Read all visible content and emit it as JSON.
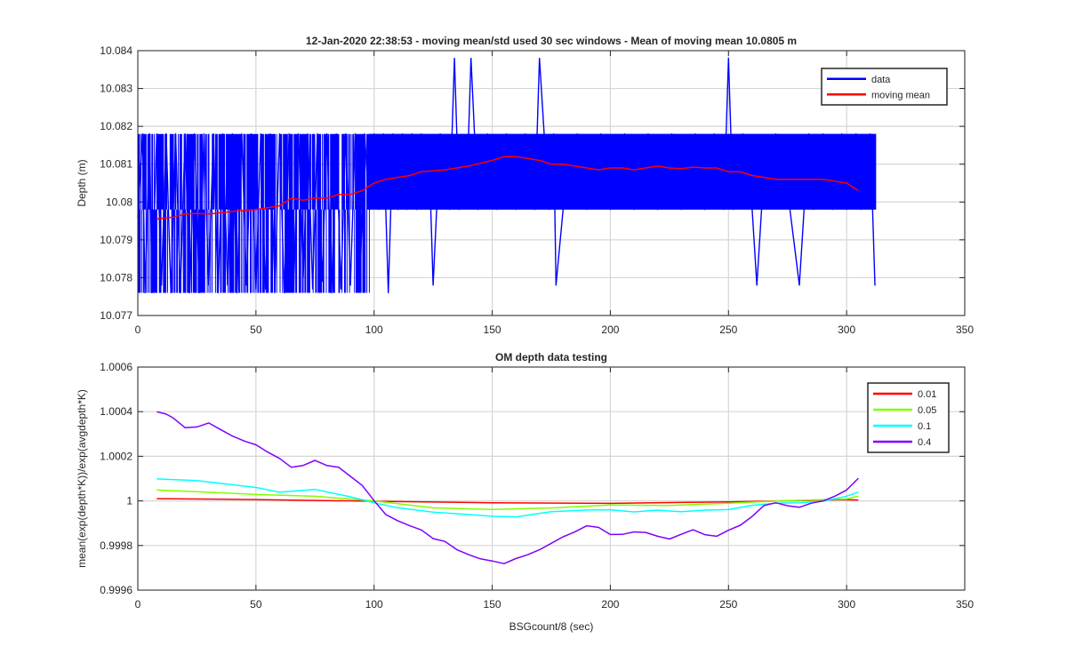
{
  "figure": {
    "background": "#ffffff"
  },
  "chart_data": [
    {
      "type": "line",
      "title": "12-Jan-2020 22:38:53 - moving mean/std used 30 sec windows - Mean of moving mean 10.0805 m",
      "xlabel": "",
      "ylabel": "Depth (m)",
      "xlim": [
        0,
        350
      ],
      "ylim": [
        10.077,
        10.084
      ],
      "xticks": [
        "0",
        "50",
        "100",
        "150",
        "200",
        "250",
        "300",
        "350"
      ],
      "yticks": [
        "10.077",
        "10.078",
        "10.079",
        "10.08",
        "10.081",
        "10.082",
        "10.083",
        "10.084"
      ],
      "grid": true,
      "legend_position": "top-right",
      "series": [
        {
          "name": "data",
          "color": "#0000ff",
          "description_x_range": [
            0,
            312.5
          ],
          "levels": [
            10.0776,
            10.0798,
            10.0818
          ],
          "x": [
            0,
            2,
            3,
            5,
            6,
            8,
            10,
            12,
            14,
            16,
            18,
            20,
            22,
            24,
            26,
            28,
            30,
            32,
            34,
            36,
            38,
            40,
            42,
            44,
            46,
            48,
            50,
            52,
            54,
            56,
            58,
            60,
            62,
            64,
            66,
            68,
            70,
            72,
            74,
            76,
            78,
            80,
            82,
            84,
            86,
            88,
            90,
            92,
            94,
            96,
            98,
            100,
            102,
            104,
            106,
            108,
            110,
            112,
            114,
            116,
            118,
            120,
            124,
            125,
            128,
            132,
            134,
            136,
            140,
            141,
            144,
            148,
            152,
            156,
            160,
            164,
            168,
            170,
            174,
            176,
            177,
            180,
            186,
            190,
            196,
            200,
            206,
            210,
            216,
            220,
            226,
            230,
            236,
            240,
            244,
            248,
            250,
            252,
            256,
            260,
            262,
            264,
            270,
            276,
            280,
            284,
            286,
            290,
            294,
            298,
            300,
            304,
            306,
            310,
            312
          ],
          "y": [
            10.0796,
            10.0818,
            10.0776,
            10.0818,
            10.0776,
            10.0818,
            10.0778,
            10.0818,
            10.0776,
            10.0818,
            10.0776,
            10.0818,
            10.0776,
            10.0818,
            10.0776,
            10.0818,
            10.0778,
            10.0818,
            10.0776,
            10.0818,
            10.0778,
            10.0818,
            10.0776,
            10.0818,
            10.0778,
            10.0818,
            10.0777,
            10.0818,
            10.0777,
            10.0818,
            10.0778,
            10.0818,
            10.0776,
            10.0818,
            10.0778,
            10.0818,
            10.078,
            10.0818,
            10.0777,
            10.0818,
            10.0779,
            10.0818,
            10.0776,
            10.0818,
            10.0777,
            10.0818,
            10.0778,
            10.0818,
            10.0778,
            10.0818,
            10.0798,
            10.0818,
            10.0798,
            10.0818,
            10.0776,
            10.0818,
            10.0798,
            10.0818,
            10.0798,
            10.0818,
            10.0798,
            10.0818,
            10.0798,
            10.0778,
            10.0818,
            10.0798,
            10.0838,
            10.0798,
            10.0818,
            10.0838,
            10.0798,
            10.0818,
            10.0798,
            10.0818,
            10.0798,
            10.0818,
            10.0798,
            10.0838,
            10.0798,
            10.0818,
            10.0778,
            10.0798,
            10.0818,
            10.0798,
            10.0818,
            10.0798,
            10.0818,
            10.0798,
            10.0818,
            10.0798,
            10.0818,
            10.0798,
            10.0818,
            10.0798,
            10.0818,
            10.0798,
            10.0838,
            10.0798,
            10.0818,
            10.0798,
            10.0778,
            10.0798,
            10.0818,
            10.0798,
            10.0778,
            10.0818,
            10.0798,
            10.0818,
            10.0798,
            10.0818,
            10.0798,
            10.0818,
            10.0798,
            10.0818,
            10.0778
          ]
        },
        {
          "name": "moving mean",
          "color": "#ff0000",
          "x": [
            8,
            15,
            20,
            25,
            30,
            40,
            50,
            55,
            60,
            65,
            70,
            75,
            80,
            85,
            90,
            95,
            100,
            105,
            110,
            115,
            120,
            130,
            140,
            150,
            155,
            160,
            165,
            170,
            175,
            180,
            185,
            190,
            195,
            200,
            205,
            210,
            215,
            220,
            225,
            230,
            235,
            240,
            245,
            250,
            255,
            260,
            265,
            270,
            275,
            280,
            285,
            290,
            295,
            300,
            305
          ],
          "y": [
            10.07955,
            10.0796,
            10.07968,
            10.0797,
            10.07968,
            10.07975,
            10.0798,
            10.07985,
            10.0799,
            10.0801,
            10.08005,
            10.0801,
            10.0801,
            10.0802,
            10.0802,
            10.0803,
            10.0805,
            10.0806,
            10.08065,
            10.0807,
            10.0808,
            10.08085,
            10.08095,
            10.0811,
            10.0812,
            10.0812,
            10.08115,
            10.0811,
            10.081,
            10.081,
            10.08095,
            10.0809,
            10.08085,
            10.0809,
            10.0809,
            10.08085,
            10.0809,
            10.08095,
            10.0809,
            10.08088,
            10.08092,
            10.0809,
            10.0809,
            10.0808,
            10.0808,
            10.0807,
            10.08065,
            10.0806,
            10.0806,
            10.0806,
            10.0806,
            10.0806,
            10.08055,
            10.0805,
            10.0803
          ]
        }
      ]
    },
    {
      "type": "line",
      "title": "OM depth data testing",
      "xlabel": "BSGcount/8 (sec)",
      "ylabel": "mean(exp(depth*K))/exp(avgdepth*K)",
      "xlim": [
        0,
        350
      ],
      "ylim": [
        0.9996,
        1.0006
      ],
      "xticks": [
        "0",
        "50",
        "100",
        "150",
        "200",
        "250",
        "300",
        "350"
      ],
      "yticks": [
        "0.9996",
        "0.9998",
        "1",
        "1.0002",
        "1.0004",
        "1.0006"
      ],
      "grid": true,
      "legend_position": "top-right",
      "series": [
        {
          "name": "0.01",
          "color": "#ff0000",
          "x": [
            8,
            50,
            100,
            150,
            200,
            250,
            300,
            305
          ],
          "y": [
            1.00001,
            1.000005,
            1.0,
            0.99999,
            0.99999,
            0.999995,
            1.000005,
            1.000005
          ]
        },
        {
          "name": "0.05",
          "color": "#80ff00",
          "x": [
            8,
            25,
            50,
            75,
            100,
            125,
            150,
            175,
            200,
            225,
            250,
            275,
            300,
            305
          ],
          "y": [
            1.00005,
            1.00004,
            1.00003,
            1.00002,
            1.0,
            0.99997,
            0.99996,
            0.99997,
            0.99998,
            0.99998,
            0.99999,
            1.0,
            1.00001,
            1.00002
          ]
        },
        {
          "name": "0.1",
          "color": "#00ffff",
          "x": [
            8,
            25,
            50,
            60,
            75,
            90,
            100,
            110,
            125,
            150,
            160,
            175,
            190,
            200,
            210,
            220,
            230,
            240,
            250,
            260,
            270,
            280,
            290,
            300,
            305
          ],
          "y": [
            1.0001,
            1.00009,
            1.00006,
            1.00004,
            1.00005,
            1.00002,
            0.99999,
            0.99997,
            0.99995,
            0.99993,
            0.99993,
            0.99995,
            0.99996,
            0.99996,
            0.99995,
            0.99996,
            0.99995,
            0.99996,
            0.99996,
            0.99998,
            0.99999,
            0.99999,
            1.0,
            1.00002,
            1.00004
          ]
        },
        {
          "name": "0.4",
          "color": "#7f00ff",
          "x": [
            8,
            12,
            15,
            20,
            25,
            30,
            35,
            40,
            45,
            50,
            55,
            60,
            65,
            70,
            75,
            80,
            85,
            90,
            95,
            100,
            105,
            110,
            115,
            120,
            125,
            130,
            135,
            140,
            145,
            150,
            155,
            160,
            165,
            170,
            175,
            180,
            185,
            190,
            195,
            200,
            205,
            210,
            215,
            220,
            225,
            230,
            235,
            240,
            245,
            250,
            255,
            260,
            265,
            270,
            275,
            280,
            285,
            290,
            295,
            300,
            305
          ],
          "y": [
            1.0004,
            1.00039,
            1.00037,
            1.00033,
            1.00033,
            1.00035,
            1.00032,
            1.00029,
            1.00027,
            1.00025,
            1.00022,
            1.00019,
            1.00015,
            1.00016,
            1.00018,
            1.00016,
            1.00015,
            1.00011,
            1.00007,
            1.0,
            0.99994,
            0.99991,
            0.99989,
            0.99987,
            0.99983,
            0.99982,
            0.99978,
            0.99976,
            0.99974,
            0.99973,
            0.99972,
            0.99974,
            0.99976,
            0.99978,
            0.99981,
            0.99984,
            0.99986,
            0.99989,
            0.99988,
            0.99985,
            0.99985,
            0.99986,
            0.99986,
            0.99984,
            0.99983,
            0.99985,
            0.99987,
            0.99985,
            0.99984,
            0.99987,
            0.99989,
            0.99993,
            0.99998,
            0.99999,
            0.99998,
            0.99997,
            0.99999,
            1.0,
            1.00002,
            1.00005,
            1.0001
          ]
        }
      ]
    }
  ]
}
